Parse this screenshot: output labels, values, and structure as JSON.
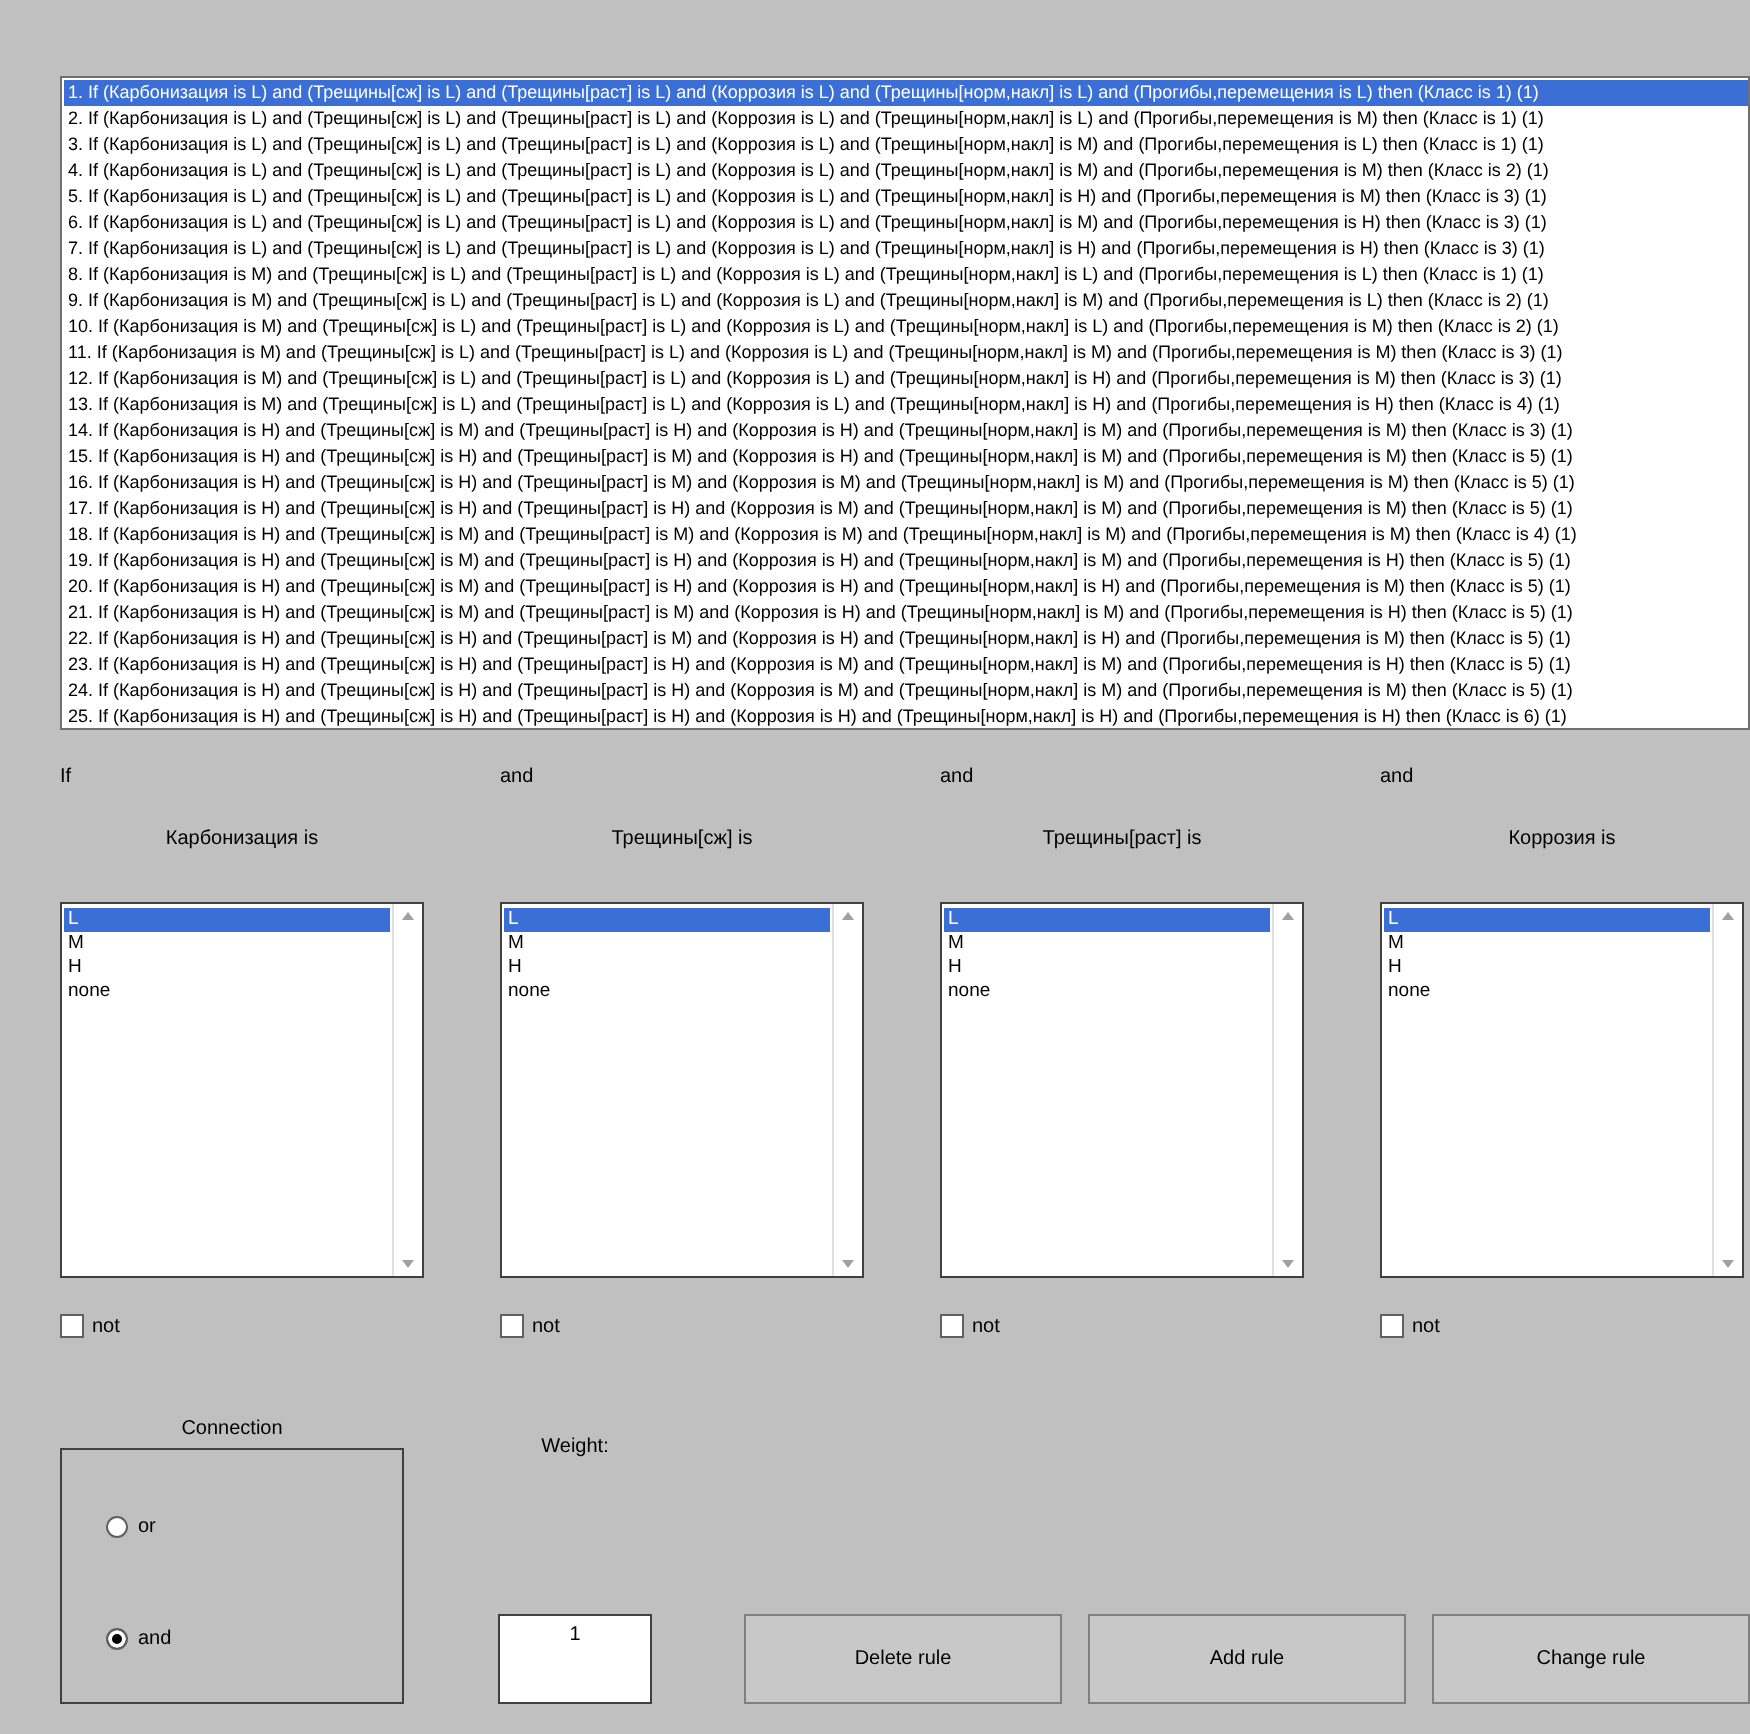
{
  "rules": [
    {
      "text": "1. If (Карбонизация is L) and (Трещины[сж] is L) and (Трещины[раст] is L) and (Коррозия is L) and (Трещины[норм,накл] is L) and (Прогибы,перемещения is L) then (Класс is 1) (1)",
      "selected": true
    },
    {
      "text": "2. If (Карбонизация is L) and (Трещины[сж] is L) and (Трещины[раст] is L) and (Коррозия is L) and (Трещины[норм,накл] is L) and (Прогибы,перемещения is M) then (Класс is 1) (1)",
      "selected": false
    },
    {
      "text": "3. If (Карбонизация is L) and (Трещины[сж] is L) and (Трещины[раст] is L) and (Коррозия is L) and (Трещины[норм,накл] is M) and (Прогибы,перемещения is L) then (Класс is 1) (1)",
      "selected": false
    },
    {
      "text": "4. If (Карбонизация is L) and (Трещины[сж] is L) and (Трещины[раст] is L) and (Коррозия is L) and (Трещины[норм,накл] is M) and (Прогибы,перемещения is M) then (Класс is 2) (1)",
      "selected": false
    },
    {
      "text": "5. If (Карбонизация is L) and (Трещины[сж] is L) and (Трещины[раст] is L) and (Коррозия is L) and (Трещины[норм,накл] is H) and (Прогибы,перемещения is M) then (Класс is 3) (1)",
      "selected": false
    },
    {
      "text": "6. If (Карбонизация is L) and (Трещины[сж] is L) and (Трещины[раст] is L) and (Коррозия is L) and (Трещины[норм,накл] is M) and (Прогибы,перемещения is H) then (Класс is 3) (1)",
      "selected": false
    },
    {
      "text": "7. If (Карбонизация is L) and (Трещины[сж] is L) and (Трещины[раст] is L) and (Коррозия is L) and (Трещины[норм,накл] is H) and (Прогибы,перемещения is H) then (Класс is 3) (1)",
      "selected": false
    },
    {
      "text": "8. If (Карбонизация is M) and (Трещины[сж] is L) and (Трещины[раст] is L) and (Коррозия is L) and (Трещины[норм,накл] is L) and (Прогибы,перемещения is L) then (Класс is 1) (1)",
      "selected": false
    },
    {
      "text": "9. If (Карбонизация is M) and (Трещины[сж] is L) and (Трещины[раст] is L) and (Коррозия is L) and (Трещины[норм,накл] is M) and (Прогибы,перемещения is L) then (Класс is 2) (1)",
      "selected": false
    },
    {
      "text": "10. If (Карбонизация is M) and (Трещины[сж] is L) and (Трещины[раст] is L) and (Коррозия is L) and (Трещины[норм,накл] is L) and (Прогибы,перемещения is M) then (Класс is 2) (1)",
      "selected": false
    },
    {
      "text": "11. If (Карбонизация is M) and (Трещины[сж] is L) and (Трещины[раст] is L) and (Коррозия is L) and (Трещины[норм,накл] is M) and (Прогибы,перемещения is M) then (Класс is 3) (1)",
      "selected": false
    },
    {
      "text": "12. If (Карбонизация is M) and (Трещины[сж] is L) and (Трещины[раст] is L) and (Коррозия is L) and (Трещины[норм,накл] is H) and (Прогибы,перемещения is M) then (Класс is 3) (1)",
      "selected": false
    },
    {
      "text": "13. If (Карбонизация is M) and (Трещины[сж] is L) and (Трещины[раст] is L) and (Коррозия is L) and (Трещины[норм,накл] is H) and (Прогибы,перемещения is H) then (Класс is 4) (1)",
      "selected": false
    },
    {
      "text": "14. If (Карбонизация is H) and (Трещины[сж] is M) and (Трещины[раст] is H) and (Коррозия is H) and (Трещины[норм,накл] is M) and (Прогибы,перемещения is M) then (Класс is 3) (1)",
      "selected": false
    },
    {
      "text": "15. If (Карбонизация is H) and (Трещины[сж] is H) and (Трещины[раст] is M) and (Коррозия is H) and (Трещины[норм,накл] is M) and (Прогибы,перемещения is M) then (Класс is 5) (1)",
      "selected": false
    },
    {
      "text": "16. If (Карбонизация is H) and (Трещины[сж] is H) and (Трещины[раст] is M) and (Коррозия is M) and (Трещины[норм,накл] is M) and (Прогибы,перемещения is M) then (Класс is 5) (1)",
      "selected": false
    },
    {
      "text": "17. If (Карбонизация is H) and (Трещины[сж] is H) and (Трещины[раст] is H) and (Коррозия is M) and (Трещины[норм,накл] is M) and (Прогибы,перемещения is M) then (Класс is 5) (1)",
      "selected": false
    },
    {
      "text": "18. If (Карбонизация is H) and (Трещины[сж] is M) and (Трещины[раст] is M) and (Коррозия is M) and (Трещины[норм,накл] is M) and (Прогибы,перемещения is M) then (Класс is 4) (1)",
      "selected": false
    },
    {
      "text": "19. If (Карбонизация is H) and (Трещины[сж] is M) and (Трещины[раст] is H) and (Коррозия is H) and (Трещины[норм,накл] is M) and (Прогибы,перемещения is H) then (Класс is 5) (1)",
      "selected": false
    },
    {
      "text": "20. If (Карбонизация is H) and (Трещины[сж] is M) and (Трещины[раст] is H) and (Коррозия is H) and (Трещины[норм,накл] is H) and (Прогибы,перемещения is M) then (Класс is 5) (1)",
      "selected": false
    },
    {
      "text": "21. If (Карбонизация is H) and (Трещины[сж] is M) and (Трещины[раст] is M) and (Коррозия is H) and (Трещины[норм,накл] is M) and (Прогибы,перемещения is H) then (Класс is 5) (1)",
      "selected": false
    },
    {
      "text": "22. If (Карбонизация is H) and (Трещины[сж] is H) and (Трещины[раст] is M) and (Коррозия is H) and (Трещины[норм,накл] is H) and (Прогибы,перемещения is M) then (Класс is 5) (1)",
      "selected": false
    },
    {
      "text": "23. If (Карбонизация is H) and (Трещины[сж] is H) and (Трещины[раст] is H) and (Коррозия is M) and (Трещины[норм,накл] is M) and (Прогибы,перемещения is H) then (Класс is 5) (1)",
      "selected": false
    },
    {
      "text": "24. If (Карбонизация is H) and (Трещины[сж] is H) and (Трещины[раст] is H) and (Коррозия is M) and (Трещины[норм,накл] is M) and (Прогибы,перемещения is M) then (Класс is 5) (1)",
      "selected": false
    },
    {
      "text": "25. If (Карбонизация is H) and (Трещины[сж] is H) and (Трещины[раст] is H) and (Коррозия is H) and (Трещины[норм,накл] is H) and (Прогибы,перемещения is H) then (Класс is 6) (1)",
      "selected": false
    }
  ],
  "inputs": [
    {
      "connective": "If",
      "label": "Карбонизация is",
      "options": [
        {
          "text": "L",
          "selected": true
        },
        {
          "text": "M",
          "selected": false
        },
        {
          "text": "H",
          "selected": false
        },
        {
          "text": "none",
          "selected": false
        }
      ],
      "not_label": "not",
      "not_checked": false
    },
    {
      "connective": "and",
      "label": "Трещины[сж] is",
      "options": [
        {
          "text": "L",
          "selected": true
        },
        {
          "text": "M",
          "selected": false
        },
        {
          "text": "H",
          "selected": false
        },
        {
          "text": "none",
          "selected": false
        }
      ],
      "not_label": "not",
      "not_checked": false
    },
    {
      "connective": "and",
      "label": "Трещины[раст] is",
      "options": [
        {
          "text": "L",
          "selected": true
        },
        {
          "text": "M",
          "selected": false
        },
        {
          "text": "H",
          "selected": false
        },
        {
          "text": "none",
          "selected": false
        }
      ],
      "not_label": "not",
      "not_checked": false
    },
    {
      "connective": "and",
      "label": "Коррозия is",
      "options": [
        {
          "text": "L",
          "selected": true
        },
        {
          "text": "M",
          "selected": false
        },
        {
          "text": "H",
          "selected": false
        },
        {
          "text": "none",
          "selected": false
        }
      ],
      "not_label": "not",
      "not_checked": false
    }
  ],
  "connection": {
    "title": "Connection",
    "options": [
      {
        "label": "or",
        "selected": false
      },
      {
        "label": "and",
        "selected": true
      }
    ]
  },
  "weight": {
    "label": "Weight:",
    "value": "1"
  },
  "buttons": [
    "Delete rule",
    "Add rule",
    "Change rule"
  ]
}
